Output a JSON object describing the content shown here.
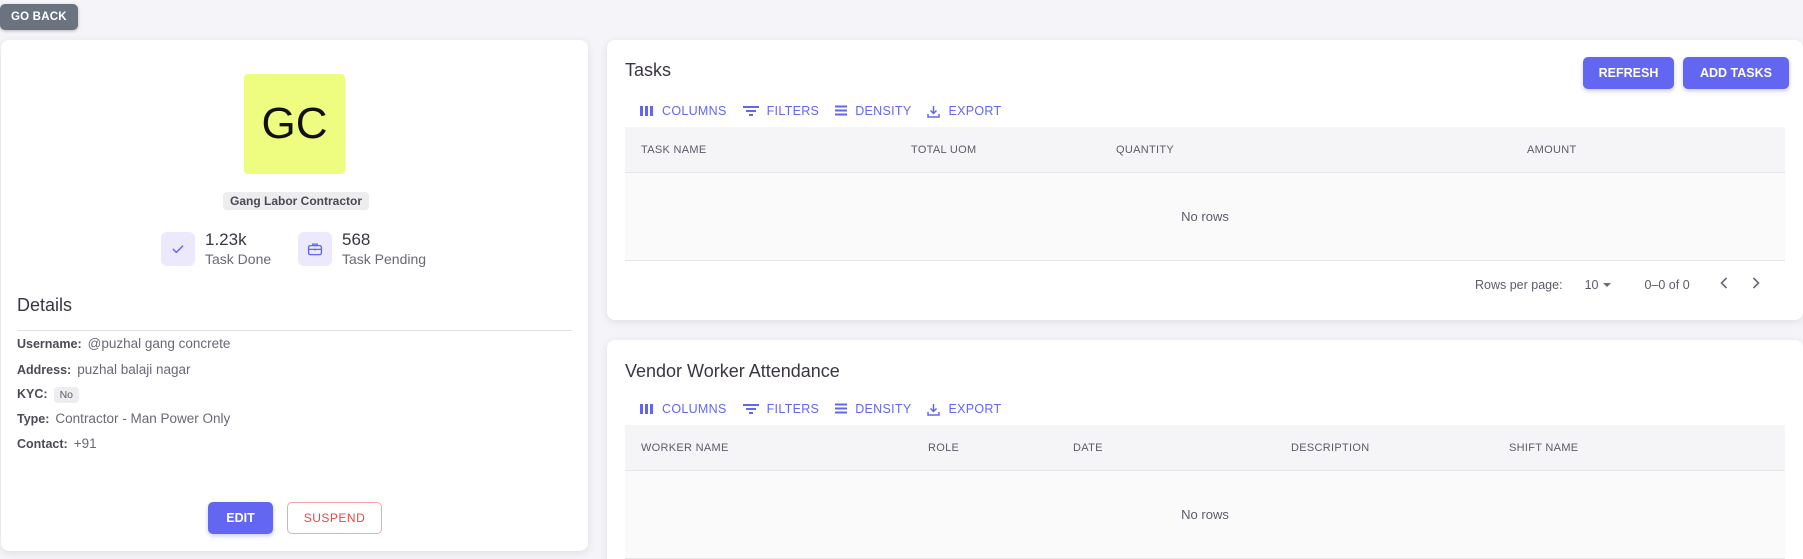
{
  "go_back_label": "GO BACK",
  "profile": {
    "initials": "GC",
    "role": "Gang Labor Contractor",
    "stats": [
      {
        "value": "1.23k",
        "label": "Task Done",
        "icon": "check-icon"
      },
      {
        "value": "568",
        "label": "Task Pending",
        "icon": "briefcase-icon"
      }
    ],
    "details_title": "Details",
    "details": {
      "username_label": "Username:",
      "username": "@puzhal gang concrete",
      "address_label": "Address:",
      "address": "puzhal balaji nagar",
      "kyc_label": "KYC:",
      "kyc": "No",
      "type_label": "Type:",
      "type": "Contractor - Man Power Only",
      "contact_label": "Contact:",
      "contact": "+91"
    },
    "edit_label": "EDIT",
    "suspend_label": "SUSPEND"
  },
  "toolbar": {
    "columns": "COLUMNS",
    "filters": "FILTERS",
    "density": "DENSITY",
    "export": "EXPORT"
  },
  "tasks": {
    "title": "Tasks",
    "refresh_label": "REFRESH",
    "add_label": "ADD TASKS",
    "columns": [
      "TASK NAME",
      "TOTAL UOM",
      "QUANTITY",
      "AMOUNT"
    ],
    "empty_text": "No rows",
    "rows_per_page_label": "Rows per page:",
    "rows_per_page": "10",
    "range": "0–0 of 0"
  },
  "attendance": {
    "title": "Vendor Worker Attendance",
    "columns": [
      "WORKER NAME",
      "ROLE",
      "DATE",
      "DESCRIPTION",
      "SHIFT NAME"
    ],
    "empty_text": "No rows"
  },
  "colors": {
    "primary": "#6366f1",
    "danger": "#ef4444",
    "avatar_bg": "#eefc7f"
  }
}
